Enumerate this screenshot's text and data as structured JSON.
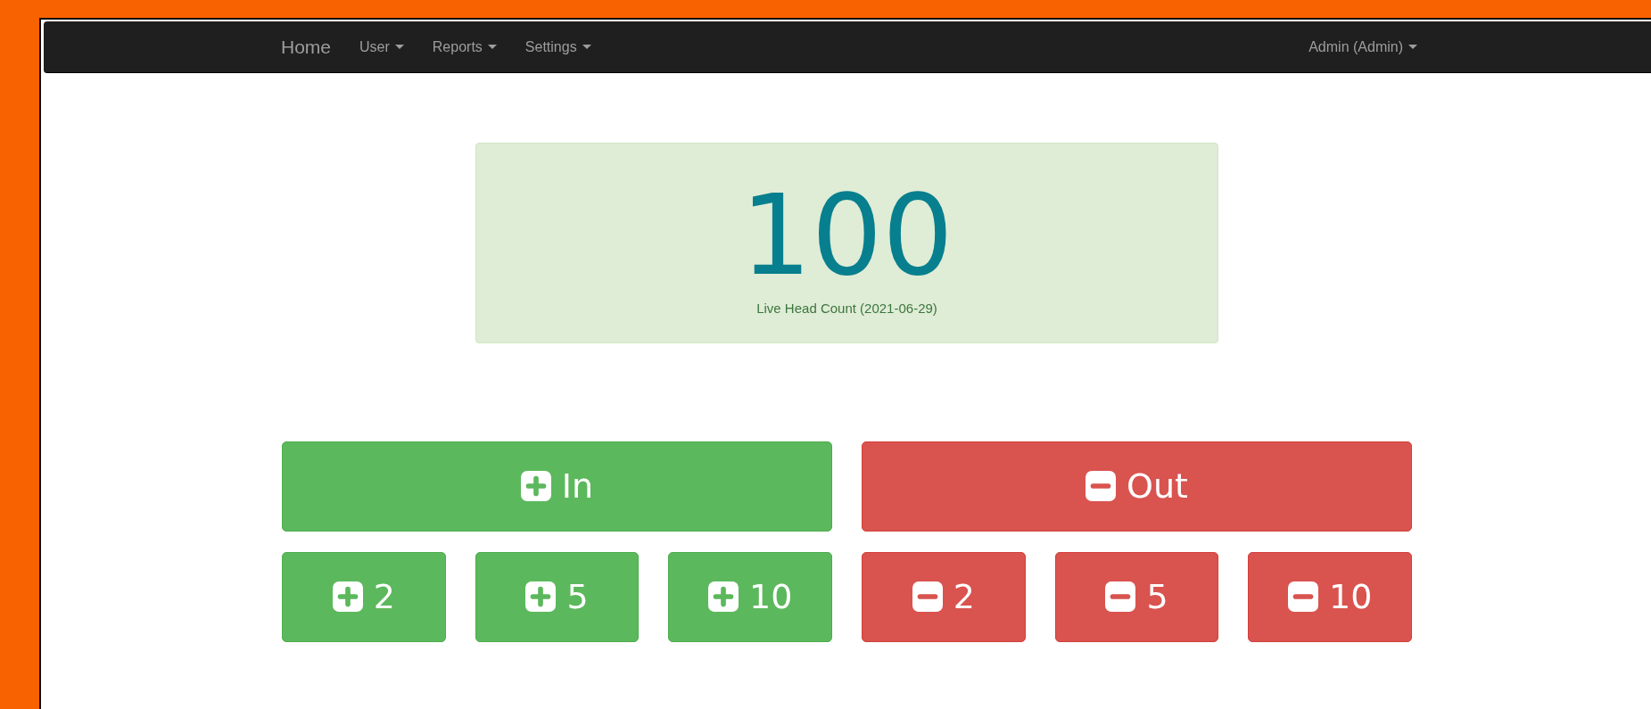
{
  "navbar": {
    "brand": "Home",
    "menus": [
      {
        "label": "User"
      },
      {
        "label": "Reports"
      },
      {
        "label": "Settings"
      }
    ],
    "user_menu": {
      "label": "Admin (Admin)"
    }
  },
  "counter": {
    "value": "100",
    "caption": "Live Head Count (2021-06-29)"
  },
  "groups": [
    {
      "kind": "in",
      "main": "In",
      "steps": [
        "2",
        "5",
        "10"
      ]
    },
    {
      "kind": "out",
      "main": "Out",
      "steps": [
        "2",
        "5",
        "10"
      ]
    }
  ]
}
